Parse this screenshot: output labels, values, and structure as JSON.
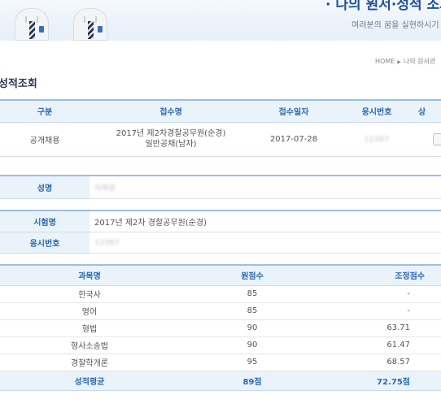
{
  "banner": {
    "title": "· 나의 원서·성적 조회",
    "subtitle": "여러분의 꿈을 실현하시기"
  },
  "breadcrumb": {
    "home": "HOME",
    "current": "나의 원서관"
  },
  "page_title": "성적조회",
  "application": {
    "headers": [
      "구분",
      "접수명",
      "접수일자",
      "응시번호",
      "상"
    ],
    "row": {
      "category": "공개채용",
      "exam_name_line1": "2017년 제2차경찰공무원(순경)",
      "exam_name_line2": "일반공채(남자)",
      "date": "2017-07-28",
      "number": "12387"
    }
  },
  "name_section": {
    "label": "성명",
    "value": "이재성"
  },
  "exam_section": {
    "exam_label": "시험명",
    "exam_value": "2017년 제2차 경찰공무원(순경)",
    "number_label": "응시번호",
    "number_value": "12387"
  },
  "scores": {
    "headers": [
      "과목명",
      "원점수",
      "조정점수"
    ],
    "rows": [
      {
        "subject": "한국사",
        "raw": "85",
        "adjusted": "-"
      },
      {
        "subject": "영어",
        "raw": "85",
        "adjusted": "-"
      },
      {
        "subject": "형법",
        "raw": "90",
        "adjusted": "63.71"
      },
      {
        "subject": "형사소송법",
        "raw": "90",
        "adjusted": "61.47"
      },
      {
        "subject": "경찰학개론",
        "raw": "95",
        "adjusted": "68.57"
      }
    ],
    "average": {
      "label": "성적평균",
      "raw": "89점",
      "adjusted": "72.75점"
    }
  },
  "colors": {
    "accent": "#2a69b3",
    "header_bg": "#eaf2fa",
    "border_top": "#9cc0e2",
    "banner_title": "#1e4f98"
  }
}
